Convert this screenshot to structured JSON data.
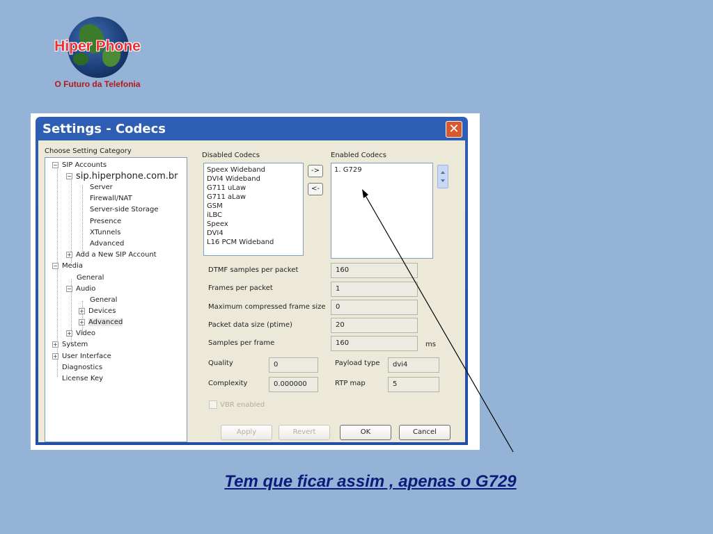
{
  "logo": {
    "name": "Hiper Phone",
    "tagline": "O Futuro da Telefonia"
  },
  "dialog": {
    "title": "Settings - Codecs",
    "close_glyph": "✕"
  },
  "tree": {
    "header": "Choose Setting Category",
    "items": [
      {
        "label": "SIP Accounts",
        "expander": "−"
      },
      {
        "label": "sip.hiperphone.com.br",
        "expander": "−"
      },
      {
        "label": "Server"
      },
      {
        "label": "Firewall/NAT"
      },
      {
        "label": "Server-side Storage"
      },
      {
        "label": "Presence"
      },
      {
        "label": "XTunnels"
      },
      {
        "label": "Advanced"
      },
      {
        "label": "Add a New SIP Account",
        "expander": "+"
      },
      {
        "label": "Media",
        "expander": "−"
      },
      {
        "label": "General"
      },
      {
        "label": "Audio",
        "expander": "−"
      },
      {
        "label": "General"
      },
      {
        "label": "Devices",
        "expander": "+"
      },
      {
        "label": "Advanced",
        "expander": "+"
      },
      {
        "label": "Video",
        "expander": "+"
      },
      {
        "label": "System",
        "expander": "+"
      },
      {
        "label": "User Interface",
        "expander": "+"
      },
      {
        "label": "Diagnostics"
      },
      {
        "label": "License Key"
      }
    ]
  },
  "codecs": {
    "disabled_label": "Disabled Codecs",
    "enabled_label": "Enabled Codecs",
    "disabled": [
      "Speex Wideband",
      "DVI4 Wideband",
      "G711 uLaw",
      "G711 aLaw",
      "GSM",
      "iLBC",
      "Speex",
      "DVI4",
      "L16 PCM Wideband"
    ],
    "enabled": [
      "1. G729"
    ],
    "move_right": "->",
    "move_left": "<-"
  },
  "settings": {
    "dtmf_label": "DTMF samples per packet",
    "dtmf_value": "160",
    "frames_label": "Frames per packet",
    "frames_value": "1",
    "maxframe_label": "Maximum compressed frame size",
    "maxframe_value": "0",
    "ptime_label": "Packet data size (ptime)",
    "ptime_value": "20",
    "samples_label": "Samples per frame",
    "samples_value": "160",
    "samples_unit": "ms",
    "quality_label": "Quality",
    "quality_value": "0",
    "payload_label": "Payload type",
    "payload_value": "dvi4",
    "complexity_label": "Complexity",
    "complexity_value": "0.000000",
    "rtpmap_label": "RTP map",
    "rtpmap_value": "5",
    "vbr_label": "VBR enabled"
  },
  "buttons": {
    "apply": "Apply",
    "revert": "Revert",
    "ok": "OK",
    "cancel": "Cancel"
  },
  "caption": "Tem que ficar  assim , apenas o G729"
}
